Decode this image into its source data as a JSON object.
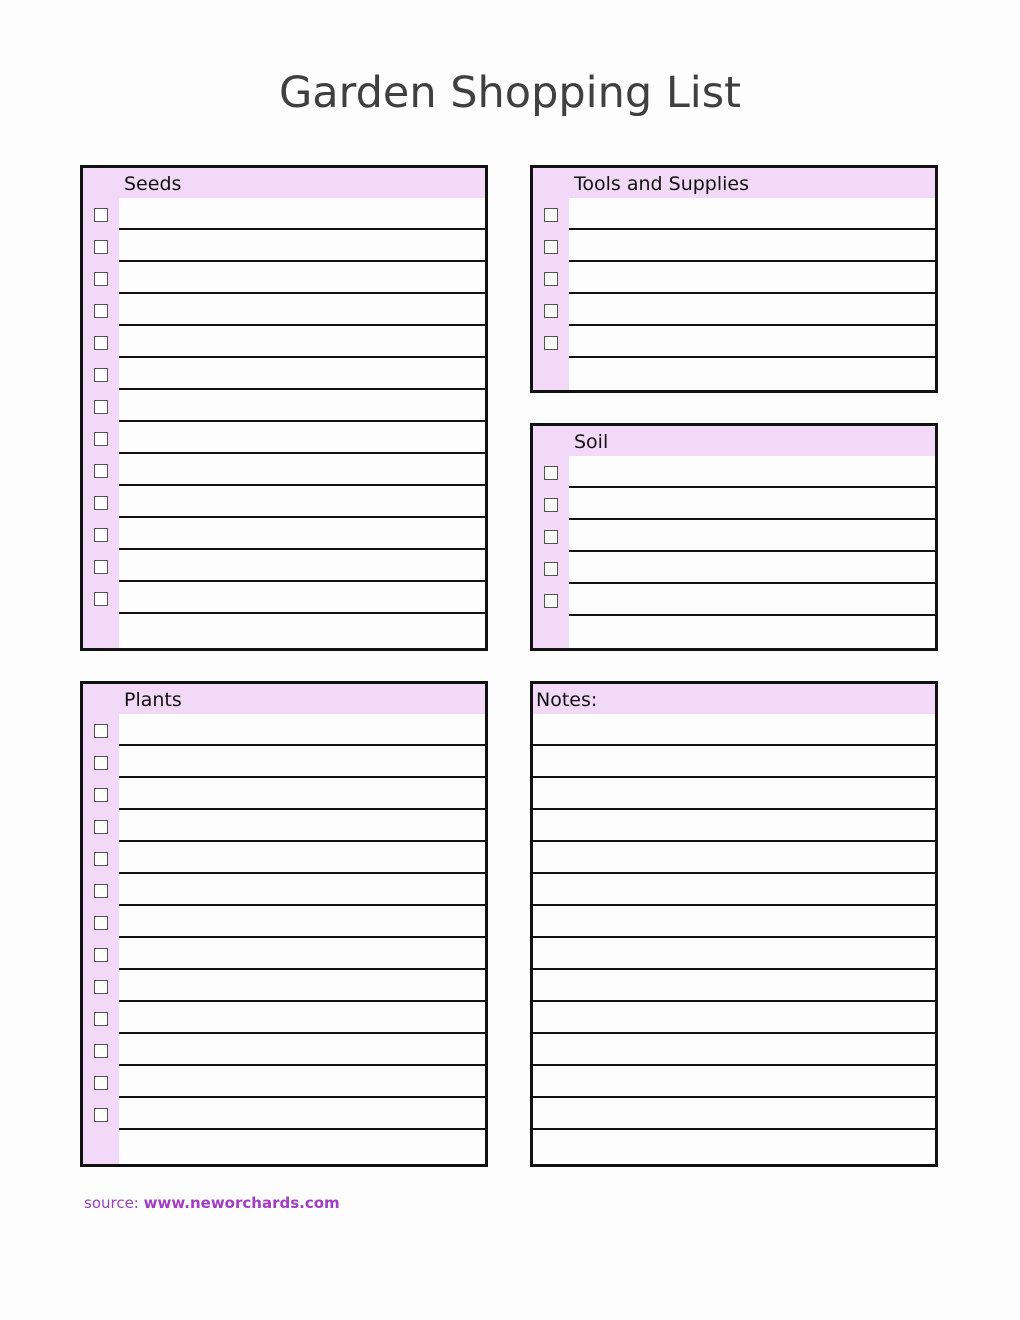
{
  "title": "Garden Shopping List",
  "colors": {
    "header_band": "#f2d9f7",
    "border": "#111111",
    "source_text": "#9b3fc0"
  },
  "sections": {
    "seeds": {
      "label": "Seeds",
      "checkbox_rows": 13,
      "total_rows": 14
    },
    "tools": {
      "label": "Tools and Supplies",
      "checkbox_rows": 5,
      "total_rows": 6
    },
    "soil": {
      "label": "Soil",
      "checkbox_rows": 5,
      "total_rows": 6
    },
    "plants": {
      "label": "Plants",
      "checkbox_rows": 13,
      "total_rows": 14
    },
    "notes": {
      "label": "Notes:",
      "checkbox_rows": 0,
      "total_rows": 14
    }
  },
  "footer": {
    "source_label": "source:",
    "source_url": "www.neworchards.com"
  }
}
